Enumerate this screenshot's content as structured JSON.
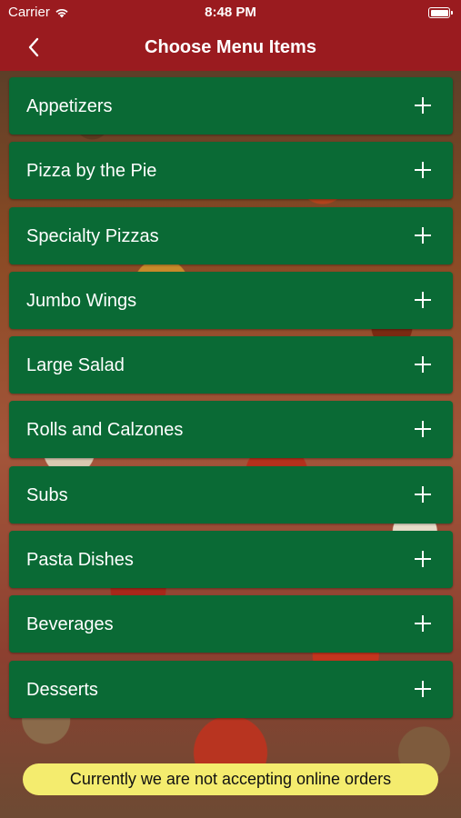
{
  "status_bar": {
    "carrier": "Carrier",
    "time": "8:48 PM",
    "wifi_icon": "wifi-icon",
    "battery_icon": "battery-icon"
  },
  "nav": {
    "title": "Choose Menu Items",
    "back_icon": "chevron-left-icon"
  },
  "menu": {
    "items": [
      {
        "label": "Appetizers"
      },
      {
        "label": "Pizza by the Pie"
      },
      {
        "label": "Specialty Pizzas"
      },
      {
        "label": "Jumbo Wings"
      },
      {
        "label": "Large Salad"
      },
      {
        "label": "Rolls and Calzones"
      },
      {
        "label": "Subs"
      },
      {
        "label": "Pasta Dishes"
      },
      {
        "label": "Beverages"
      },
      {
        "label": "Desserts"
      }
    ]
  },
  "notice": {
    "text": "Currently we are not accepting online orders"
  },
  "colors": {
    "header": "#9a1b1f",
    "menu_item": "#0a6a35",
    "notice_bg": "#f4ec6e"
  }
}
